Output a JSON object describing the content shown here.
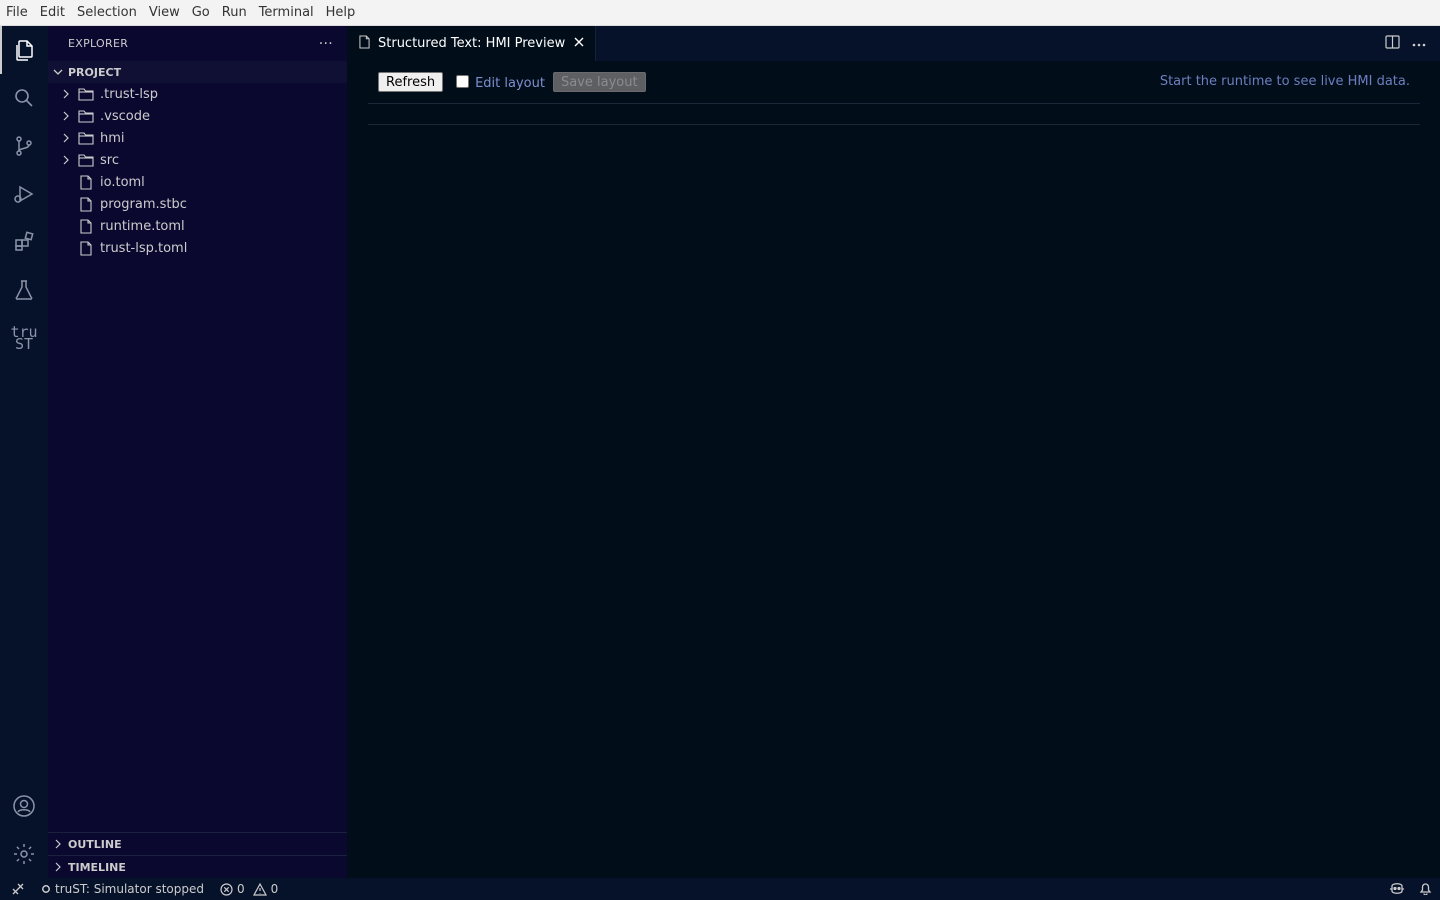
{
  "menu": [
    "File",
    "Edit",
    "Selection",
    "View",
    "Go",
    "Run",
    "Terminal",
    "Help"
  ],
  "activity_bar": {
    "icons": [
      "explorer-icon",
      "search-icon",
      "source-control-icon",
      "run-debug-icon",
      "extensions-icon",
      "testing-icon",
      "trust-icon"
    ],
    "trust_logo": {
      "line1": "tru",
      "line2": "ST"
    },
    "bottom_icons": [
      "account-icon",
      "settings-gear-icon"
    ]
  },
  "sidebar": {
    "title": "EXPLORER",
    "more": "···",
    "section": "PROJECT",
    "items": [
      {
        "label": ".trust-lsp",
        "type": "folder"
      },
      {
        "label": ".vscode",
        "type": "folder"
      },
      {
        "label": "hmi",
        "type": "folder"
      },
      {
        "label": "src",
        "type": "folder"
      },
      {
        "label": "io.toml",
        "type": "file"
      },
      {
        "label": "program.stbc",
        "type": "file"
      },
      {
        "label": "runtime.toml",
        "type": "file"
      },
      {
        "label": "trust-lsp.toml",
        "type": "file"
      }
    ],
    "outline": "OUTLINE",
    "timeline": "TIMELINE"
  },
  "editor": {
    "tab_title": "Structured Text: HMI Preview",
    "refresh_label": "Refresh",
    "edit_layout_label": "Edit layout",
    "edit_layout_checked": false,
    "save_layout_label": "Save layout",
    "hint": "Start the runtime to see live HMI data."
  },
  "statusbar": {
    "runtime_status": "truST: Simulator stopped",
    "errors": "0",
    "warnings": "0"
  },
  "colors": {
    "editor_bg": "#020d1a",
    "sidebar_bg": "#0b0830",
    "activity_bg": "#06112a",
    "hint": "#6c7fbf"
  }
}
